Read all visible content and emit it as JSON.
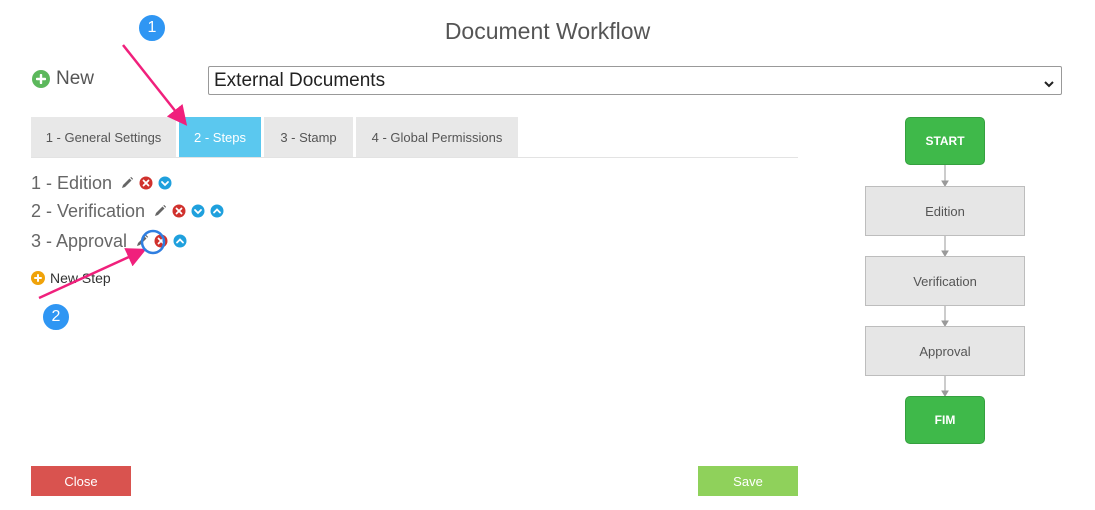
{
  "dialog": {
    "title": "Document Workflow"
  },
  "new_label": "New",
  "workflow_select": {
    "selected": "External Documents"
  },
  "tabs": [
    {
      "label": "1 - General Settings"
    },
    {
      "label": "2 - Steps",
      "active": true
    },
    {
      "label": "3 - Stamp"
    },
    {
      "label": "4 - Global Permissions"
    }
  ],
  "steps": [
    {
      "label": "1 - Edition"
    },
    {
      "label": "2 - Verification"
    },
    {
      "label": "3 - Approval"
    }
  ],
  "new_step_label": "New Step",
  "buttons": {
    "close": "Close",
    "save": "Save"
  },
  "flowchart": {
    "start": "START",
    "nodes": [
      "Edition",
      "Verification",
      "Approval"
    ],
    "end": "FIM"
  },
  "annotations": {
    "badge1": "1",
    "badge2": "2"
  },
  "colors": {
    "accent_tab": "#5bc8ef",
    "close": "#d9534f",
    "save": "#8fd15b",
    "flow_green": "#3fb94a",
    "annotation_arrow": "#f0207c",
    "annotation_badge": "#2f96f3"
  }
}
